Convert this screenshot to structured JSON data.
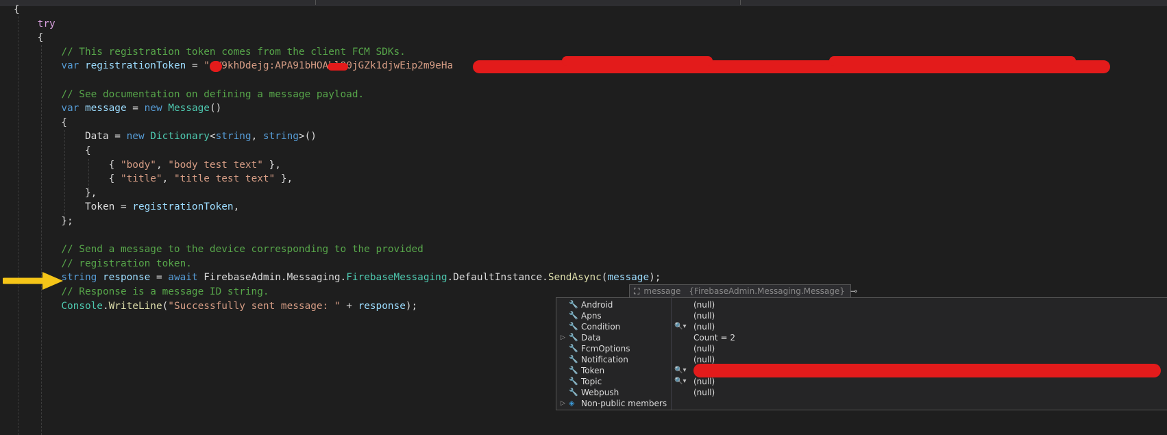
{
  "code_lines": [
    {
      "segments": [
        {
          "t": "{",
          "k": "pl"
        }
      ]
    },
    {
      "segments": [
        {
          "t": "    ",
          "k": "pl"
        },
        {
          "t": "try",
          "k": "kwc"
        }
      ]
    },
    {
      "segments": [
        {
          "t": "    {",
          "k": "pl"
        }
      ]
    },
    {
      "segments": [
        {
          "t": "        ",
          "k": "pl"
        },
        {
          "t": "// This registration token comes from the client FCM SDKs.",
          "k": "c"
        }
      ]
    },
    {
      "segments": [
        {
          "t": "        ",
          "k": "pl"
        },
        {
          "t": "var",
          "k": "kw"
        },
        {
          "t": " ",
          "k": "pl"
        },
        {
          "t": "registrationToken",
          "k": "id"
        },
        {
          "t": " = ",
          "k": "pl"
        },
        {
          "t": "\"eW9khDdejg:APA91bHOAhlO0jGZk1djwEip2m9eHa",
          "k": "str"
        },
        {
          "t": "                                                                                 ",
          "k": "pl"
        },
        {
          "t": "\"",
          "k": "str"
        },
        {
          "t": ";",
          "k": "pl"
        }
      ]
    },
    {
      "segments": []
    },
    {
      "segments": [
        {
          "t": "        ",
          "k": "pl"
        },
        {
          "t": "// See documentation on defining a message payload.",
          "k": "c"
        }
      ]
    },
    {
      "segments": [
        {
          "t": "        ",
          "k": "pl"
        },
        {
          "t": "var",
          "k": "kw"
        },
        {
          "t": " ",
          "k": "pl"
        },
        {
          "t": "message",
          "k": "id"
        },
        {
          "t": " = ",
          "k": "pl"
        },
        {
          "t": "new",
          "k": "kw"
        },
        {
          "t": " ",
          "k": "pl"
        },
        {
          "t": "Message",
          "k": "ty"
        },
        {
          "t": "()",
          "k": "pl"
        }
      ]
    },
    {
      "segments": [
        {
          "t": "        {",
          "k": "pl"
        }
      ]
    },
    {
      "segments": [
        {
          "t": "            ",
          "k": "pl"
        },
        {
          "t": "Data",
          "k": "pl"
        },
        {
          "t": " = ",
          "k": "pl"
        },
        {
          "t": "new",
          "k": "kw"
        },
        {
          "t": " ",
          "k": "pl"
        },
        {
          "t": "Dictionary",
          "k": "ty"
        },
        {
          "t": "<",
          "k": "pl"
        },
        {
          "t": "string",
          "k": "kw"
        },
        {
          "t": ", ",
          "k": "pl"
        },
        {
          "t": "string",
          "k": "kw"
        },
        {
          "t": ">()",
          "k": "pl"
        }
      ]
    },
    {
      "segments": [
        {
          "t": "            {",
          "k": "pl"
        }
      ]
    },
    {
      "segments": [
        {
          "t": "                { ",
          "k": "pl"
        },
        {
          "t": "\"body\"",
          "k": "str"
        },
        {
          "t": ", ",
          "k": "pl"
        },
        {
          "t": "\"body test text\"",
          "k": "str"
        },
        {
          "t": " },",
          "k": "pl"
        }
      ]
    },
    {
      "segments": [
        {
          "t": "                { ",
          "k": "pl"
        },
        {
          "t": "\"title\"",
          "k": "str"
        },
        {
          "t": ", ",
          "k": "pl"
        },
        {
          "t": "\"title test text\"",
          "k": "str"
        },
        {
          "t": " },",
          "k": "pl"
        }
      ]
    },
    {
      "segments": [
        {
          "t": "            },",
          "k": "pl"
        }
      ]
    },
    {
      "segments": [
        {
          "t": "            ",
          "k": "pl"
        },
        {
          "t": "Token",
          "k": "pl"
        },
        {
          "t": " = ",
          "k": "pl"
        },
        {
          "t": "registrationToken",
          "k": "id"
        },
        {
          "t": ",",
          "k": "pl"
        }
      ]
    },
    {
      "segments": [
        {
          "t": "        };",
          "k": "pl"
        }
      ]
    },
    {
      "segments": []
    },
    {
      "segments": [
        {
          "t": "        ",
          "k": "pl"
        },
        {
          "t": "// Send a message to the device corresponding to the provided",
          "k": "c"
        }
      ]
    },
    {
      "segments": [
        {
          "t": "        ",
          "k": "pl"
        },
        {
          "t": "// registration token.",
          "k": "c"
        }
      ]
    },
    {
      "segments": [
        {
          "t": "        ",
          "k": "pl"
        },
        {
          "t": "string",
          "k": "kw"
        },
        {
          "t": " ",
          "k": "pl"
        },
        {
          "t": "response",
          "k": "id"
        },
        {
          "t": " = ",
          "k": "pl"
        },
        {
          "t": "await",
          "k": "kw"
        },
        {
          "t": " FirebaseAdmin.Messaging.",
          "k": "pl"
        },
        {
          "t": "FirebaseMessaging",
          "k": "ty"
        },
        {
          "t": ".DefaultInstance.",
          "k": "pl"
        },
        {
          "t": "SendAsync",
          "k": "fn"
        },
        {
          "t": "(",
          "k": "pl"
        },
        {
          "t": "message",
          "k": "id"
        },
        {
          "t": ");",
          "k": "pl"
        }
      ]
    },
    {
      "segments": [
        {
          "t": "        ",
          "k": "pl"
        },
        {
          "t": "// Response is a message ID string.",
          "k": "c"
        }
      ]
    },
    {
      "segments": [
        {
          "t": "        ",
          "k": "pl"
        },
        {
          "t": "Console",
          "k": "ty"
        },
        {
          "t": ".",
          "k": "pl"
        },
        {
          "t": "WriteLine",
          "k": "fn"
        },
        {
          "t": "(",
          "k": "pl"
        },
        {
          "t": "\"Successfully sent message: \"",
          "k": "str"
        },
        {
          "t": " + ",
          "k": "pl"
        },
        {
          "t": "response",
          "k": "id"
        },
        {
          "t": ");",
          "k": "pl"
        }
      ]
    }
  ],
  "datatip": {
    "variable": "message",
    "type": "{FirebaseAdmin.Messaging.Message}",
    "rows": [
      {
        "name": "Android",
        "value": "(null)",
        "expandable": false,
        "search": false,
        "icon": "wrench-icon"
      },
      {
        "name": "Apns",
        "value": "(null)",
        "expandable": false,
        "search": false,
        "icon": "wrench-icon"
      },
      {
        "name": "Condition",
        "value": "(null)",
        "expandable": false,
        "search": true,
        "icon": "wrench-icon"
      },
      {
        "name": "Data",
        "value": "Count = 2",
        "expandable": true,
        "search": false,
        "icon": "wrench-icon"
      },
      {
        "name": "FcmOptions",
        "value": "(null)",
        "expandable": false,
        "search": false,
        "icon": "wrench-icon"
      },
      {
        "name": "Notification",
        "value": "(null)",
        "expandable": false,
        "search": false,
        "icon": "wrench-icon"
      },
      {
        "name": "Token",
        "value": "",
        "expandable": false,
        "search": true,
        "icon": "wrench-icon"
      },
      {
        "name": "Topic",
        "value": "(null)",
        "expandable": false,
        "search": true,
        "icon": "wrench-icon"
      },
      {
        "name": "Webpush",
        "value": "(null)",
        "expandable": false,
        "search": false,
        "icon": "wrench-icon"
      },
      {
        "name": "Non-public members",
        "value": "",
        "expandable": true,
        "search": false,
        "icon": "cube-icon"
      }
    ]
  },
  "colors": {
    "editor_bg": "#1e1e1e",
    "comment": "#57a64a",
    "keyword": "#569cd6",
    "control_keyword": "#d8a0df",
    "string": "#d69d85",
    "identifier": "#9cdcfe",
    "type": "#4ec9b0",
    "method": "#dcdcaa",
    "redaction": "#e31b1b",
    "arrow": "#f5c518"
  }
}
